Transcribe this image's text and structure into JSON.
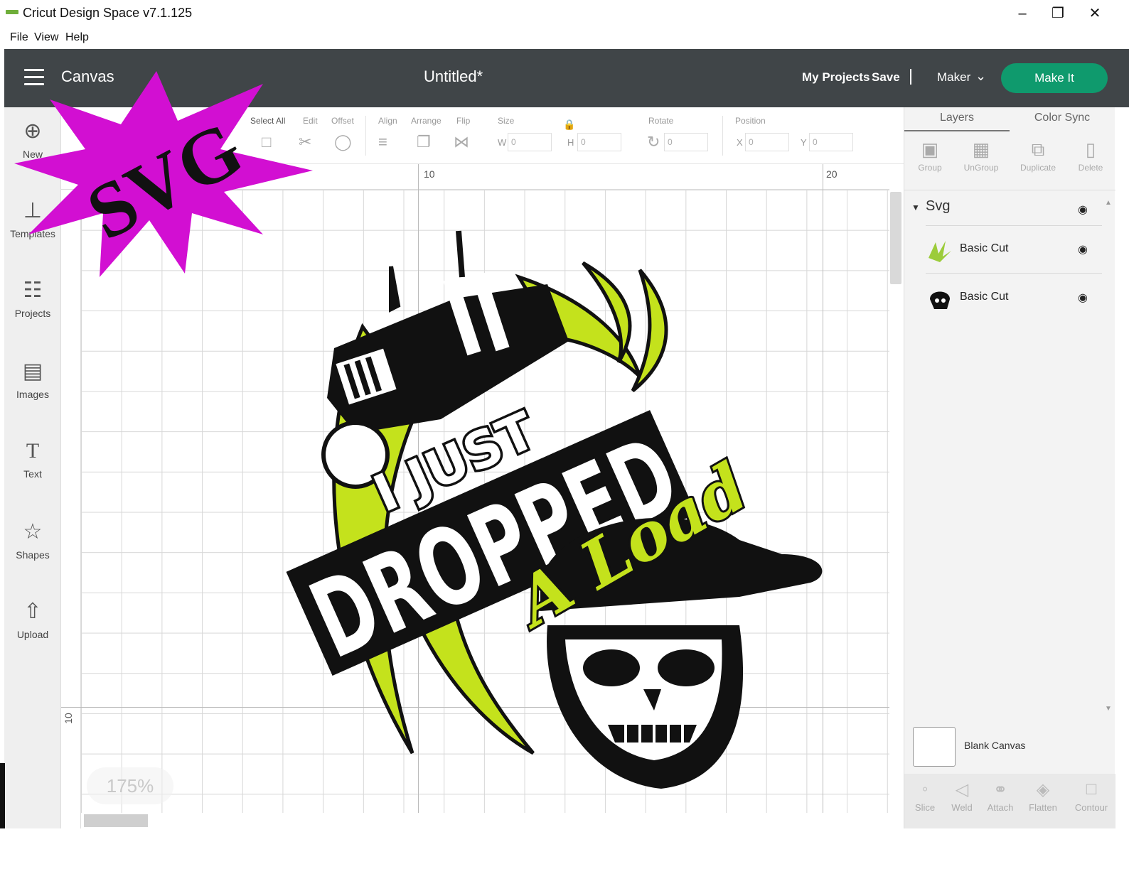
{
  "window": {
    "title": "Cricut Design Space v7.1.125",
    "controls": [
      "–",
      "❐",
      "✕"
    ]
  },
  "menu": [
    "File",
    "View",
    "Help"
  ],
  "header": {
    "section": "Canvas",
    "document": "Untitled*",
    "my_projects": "My Projects",
    "save": "Save",
    "machine": "Maker",
    "make_it": "Make It"
  },
  "left_tools": [
    {
      "label": "New",
      "icon": "plus-circle-icon"
    },
    {
      "label": "Templates",
      "icon": "shirt-icon"
    },
    {
      "label": "Projects",
      "icon": "projects-icon"
    },
    {
      "label": "Images",
      "icon": "image-icon"
    },
    {
      "label": "Text",
      "icon": "text-icon"
    },
    {
      "label": "Shapes",
      "icon": "shapes-icon"
    },
    {
      "label": "Upload",
      "icon": "upload-icon"
    }
  ],
  "edit_toolbar": {
    "select_all": "Select All",
    "edit": "Edit",
    "offset": "Offset",
    "align": "Align",
    "arrange": "Arrange",
    "flip": "Flip",
    "size": "Size",
    "rotate": "Rotate",
    "position": "Position",
    "w_label": "W",
    "h_label": "H",
    "x_label": "X",
    "y_label": "Y",
    "w_value": "0",
    "h_value": "0",
    "rotate_value": "0",
    "x_value": "0",
    "y_value": "0"
  },
  "rulers": {
    "h_10": "10",
    "h_20": "20",
    "v_10": "10"
  },
  "zoom": "175%",
  "badge": {
    "text": "SVG",
    "color": "#d20fd2"
  },
  "artwork": {
    "line1": "I JUST",
    "line2": "DROPPED",
    "line3": "A Load",
    "accent_color": "#c4e21c"
  },
  "right_panel": {
    "tabs": [
      "Layers",
      "Color Sync"
    ],
    "actions": [
      "Group",
      "UnGroup",
      "Duplicate",
      "Delete"
    ],
    "group_name": "Svg",
    "layers": [
      {
        "name": "Basic Cut",
        "thumb_color": "#9ccc3a"
      },
      {
        "name": "Basic Cut",
        "thumb_color": "#111111"
      }
    ],
    "blank_canvas": "Blank Canvas",
    "bottom_actions": [
      "Slice",
      "Weld",
      "Attach",
      "Flatten",
      "Contour"
    ]
  }
}
